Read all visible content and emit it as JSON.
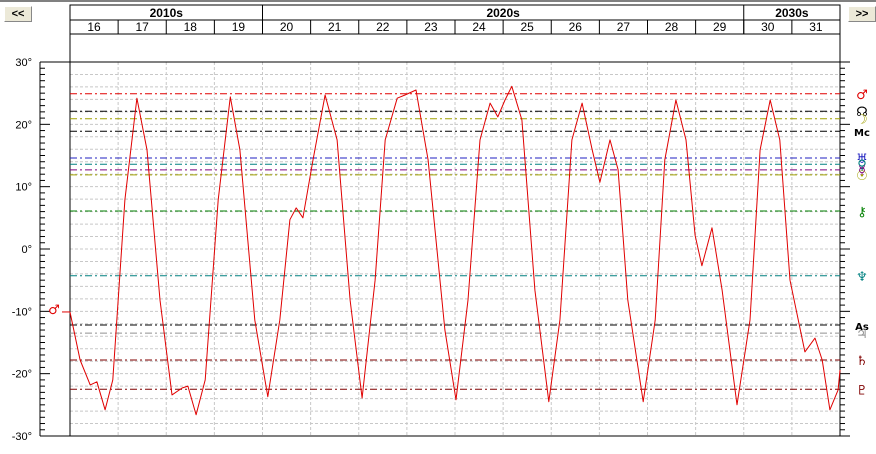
{
  "nav": {
    "prev_label": "<<",
    "next_label": ">>"
  },
  "chart_data": {
    "type": "line",
    "title": "",
    "xlabel": "",
    "ylabel": "",
    "xlim": [
      2016,
      2032
    ],
    "ylim": [
      -30,
      30
    ],
    "decades": [
      {
        "label": "2010s",
        "from": 2016,
        "to": 2020
      },
      {
        "label": "2020s",
        "from": 2020,
        "to": 2030
      },
      {
        "label": "2030s",
        "from": 2030,
        "to": 2032
      }
    ],
    "year_labels": [
      "16",
      "17",
      "18",
      "19",
      "20",
      "21",
      "22",
      "23",
      "24",
      "25",
      "26",
      "27",
      "28",
      "29",
      "30",
      "31"
    ],
    "y_ticks": [
      {
        "v": 30,
        "label": "30°"
      },
      {
        "v": 20,
        "label": "20°"
      },
      {
        "v": 10,
        "label": "10°"
      },
      {
        "v": 0,
        "label": "0°"
      },
      {
        "v": -10,
        "label": "-10°"
      },
      {
        "v": -20,
        "label": "-20°"
      },
      {
        "v": -30,
        "label": "-30°"
      }
    ],
    "grid": true,
    "series": [
      {
        "name": "Mars declination",
        "glyph": "♂",
        "color": "#e00000",
        "points": [
          [
            16.0,
            -10.1
          ],
          [
            16.21,
            -17.8
          ],
          [
            16.42,
            -21.8
          ],
          [
            16.56,
            -21.3
          ],
          [
            16.73,
            -25.8
          ],
          [
            16.89,
            -21.0
          ],
          [
            17.14,
            7.9
          ],
          [
            17.39,
            24.2
          ],
          [
            17.6,
            15.9
          ],
          [
            17.87,
            -8.2
          ],
          [
            18.12,
            -23.4
          ],
          [
            18.33,
            -22.3
          ],
          [
            18.45,
            -22.0
          ],
          [
            18.62,
            -26.6
          ],
          [
            18.81,
            -21.0
          ],
          [
            19.08,
            7.9
          ],
          [
            19.33,
            24.4
          ],
          [
            19.53,
            15.9
          ],
          [
            19.84,
            -11.4
          ],
          [
            20.11,
            -23.7
          ],
          [
            20.36,
            -11.4
          ],
          [
            20.57,
            4.7
          ],
          [
            20.7,
            6.6
          ],
          [
            20.84,
            5.0
          ],
          [
            21.05,
            14.3
          ],
          [
            21.3,
            24.7
          ],
          [
            21.55,
            17.5
          ],
          [
            21.82,
            -8.2
          ],
          [
            22.07,
            -23.9
          ],
          [
            22.34,
            -5.0
          ],
          [
            22.55,
            17.5
          ],
          [
            22.8,
            24.2
          ],
          [
            22.96,
            24.7
          ],
          [
            23.19,
            25.5
          ],
          [
            23.44,
            14.3
          ],
          [
            23.79,
            -13.0
          ],
          [
            24.02,
            -24.2
          ],
          [
            24.27,
            -8.2
          ],
          [
            24.52,
            17.5
          ],
          [
            24.73,
            23.4
          ],
          [
            24.89,
            21.2
          ],
          [
            25.04,
            23.9
          ],
          [
            25.18,
            26.1
          ],
          [
            25.39,
            20.7
          ],
          [
            25.66,
            -6.6
          ],
          [
            25.95,
            -24.5
          ],
          [
            26.18,
            -11.4
          ],
          [
            26.43,
            17.5
          ],
          [
            26.64,
            23.4
          ],
          [
            26.85,
            15.9
          ],
          [
            27.01,
            10.7
          ],
          [
            27.22,
            17.5
          ],
          [
            27.39,
            12.7
          ],
          [
            27.59,
            -8.2
          ],
          [
            27.91,
            -24.5
          ],
          [
            28.16,
            -11.4
          ],
          [
            28.36,
            14.3
          ],
          [
            28.59,
            23.9
          ],
          [
            28.8,
            17.5
          ],
          [
            28.99,
            2.2
          ],
          [
            29.13,
            -2.7
          ],
          [
            29.34,
            3.4
          ],
          [
            29.55,
            -6.6
          ],
          [
            29.86,
            -25.0
          ],
          [
            30.13,
            -11.4
          ],
          [
            30.34,
            15.9
          ],
          [
            30.55,
            23.9
          ],
          [
            30.75,
            17.5
          ],
          [
            30.96,
            -5.0
          ],
          [
            31.27,
            -16.5
          ],
          [
            31.48,
            -14.3
          ],
          [
            31.63,
            -17.8
          ],
          [
            31.79,
            -25.8
          ],
          [
            31.96,
            -22.6
          ],
          [
            32.0,
            -19.4
          ]
        ]
      }
    ],
    "reference_lines": [
      {
        "name": "Mars",
        "glyph": "♂",
        "value": 24.9,
        "color": "#e00000"
      },
      {
        "name": "Node",
        "glyph": "☊",
        "value": 22.1,
        "color": "#000000"
      },
      {
        "name": "Moon",
        "glyph": "☽",
        "value": 20.9,
        "color": "#a0a000"
      },
      {
        "name": "MC",
        "glyph": "Mc",
        "value": 18.9,
        "color": "#000000"
      },
      {
        "name": "Uranus",
        "glyph": "♅",
        "value": 14.6,
        "color": "#2020c0"
      },
      {
        "name": "Venus",
        "glyph": "♀",
        "value": 13.6,
        "color": "#008080"
      },
      {
        "name": "Mercury",
        "glyph": "☿",
        "value": 12.7,
        "color": "#800080"
      },
      {
        "name": "Sun",
        "glyph": "☉",
        "value": 11.9,
        "color": "#a0a000"
      },
      {
        "name": "Chiron",
        "glyph": "⚷",
        "value": 6.1,
        "color": "#008000"
      },
      {
        "name": "Neptune",
        "glyph": "♆",
        "value": -4.3,
        "color": "#008080"
      },
      {
        "name": "Ascendant",
        "glyph": "As",
        "value": -12.2,
        "color": "#000000"
      },
      {
        "name": "Jupiter",
        "glyph": "♃",
        "value": -13.5,
        "color": "#909090"
      },
      {
        "name": "Saturn",
        "glyph": "♄",
        "value": -17.8,
        "color": "#800000"
      },
      {
        "name": "Pluto",
        "glyph": "♇",
        "value": -22.5,
        "color": "#800000"
      }
    ],
    "start_marker": {
      "glyph": "♂",
      "color": "#e00000"
    }
  }
}
